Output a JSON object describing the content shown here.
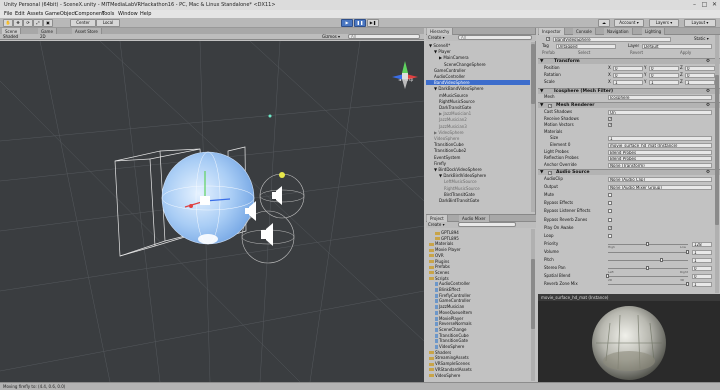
{
  "window": {
    "title": "Unity Personal (64bit) - SceneX.unity - MITMediaLabVRHackathon16 - PC, Mac & Linux Standalone* <DX11>",
    "minimize": "–",
    "maximize": "□",
    "close": "✕"
  },
  "menu": [
    "File",
    "Edit",
    "Assets",
    "GameObject",
    "Component",
    "Tools",
    "Window",
    "Help"
  ],
  "toolbar": {
    "center_label": "Center",
    "local_label": "Local",
    "play_icon": "▶",
    "pause_icon": "❚❚",
    "step_icon": "▶❚",
    "account_label": "Account ▾",
    "layers_label": "Layers ▾",
    "layout_label": "Layout ▾",
    "cloud_icon": "☁"
  },
  "scene": {
    "tabs": [
      "Scene",
      "Game",
      "Asset Store"
    ],
    "shaded_label": "Shaded",
    "twod_label": "2D",
    "gizmos_label": "Gizmos ▾",
    "search_placeholder": "All",
    "persp_label": "◄ Persp"
  },
  "hierarchy": {
    "tab": "Hierarchy",
    "create_label": "Create ▾",
    "search_placeholder": "All",
    "items": [
      {
        "label": "▼ SceneX*",
        "indent": 0,
        "state": "normal"
      },
      {
        "label": "▼ Player",
        "indent": 1,
        "state": "normal"
      },
      {
        "label": "▶ MainCamera",
        "indent": 2,
        "state": "normal"
      },
      {
        "label": "SceneChangeSphere",
        "indent": 3,
        "state": "normal"
      },
      {
        "label": "GameController",
        "indent": 1,
        "state": "normal"
      },
      {
        "label": "AudioController",
        "indent": 1,
        "state": "normal"
      },
      {
        "label": "BandVideoSphere",
        "indent": 1,
        "state": "selected"
      },
      {
        "label": "▼ DarkBandVideoSphere",
        "indent": 1,
        "state": "normal"
      },
      {
        "label": "mMusicSource",
        "indent": 2,
        "state": "normal"
      },
      {
        "label": "RightMusicSource",
        "indent": 2,
        "state": "normal"
      },
      {
        "label": "DarkTransitGate",
        "indent": 2,
        "state": "normal"
      },
      {
        "label": "▶ JazzMusician1",
        "indent": 2,
        "state": "gray"
      },
      {
        "label": "JazzMusician2",
        "indent": 2,
        "state": "gray"
      },
      {
        "label": "JazzMusician3",
        "indent": 2,
        "state": "gray"
      },
      {
        "label": "▶ VideoSphere",
        "indent": 1,
        "state": "gray"
      },
      {
        "label": "VideoSphere",
        "indent": 1,
        "state": "gray"
      },
      {
        "label": "TransitionCube",
        "indent": 1,
        "state": "normal"
      },
      {
        "label": "TransitionCube2",
        "indent": 1,
        "state": "normal"
      },
      {
        "label": "EventSystem",
        "indent": 1,
        "state": "normal"
      },
      {
        "label": "Firefly",
        "indent": 1,
        "state": "normal"
      },
      {
        "label": "▼ BirdDockVideoSphere",
        "indent": 1,
        "state": "normal"
      },
      {
        "label": "▼ DarkBirdVideoSphere",
        "indent": 2,
        "state": "normal"
      },
      {
        "label": "LeftMusicSource",
        "indent": 3,
        "state": "gray"
      },
      {
        "label": "RightMusicSource",
        "indent": 3,
        "state": "gray"
      },
      {
        "label": "BirdTransitGate",
        "indent": 3,
        "state": "normal"
      },
      {
        "label": "DarkBirdTransitGate",
        "indent": 2,
        "state": "normal"
      }
    ]
  },
  "project": {
    "tabs": [
      "Project",
      "Audio Mixer"
    ],
    "create_label": "Create ▾",
    "items": [
      {
        "label": "GPTL894",
        "kind": "folder",
        "indent": 1
      },
      {
        "label": "GPTL895",
        "kind": "folder",
        "indent": 1
      },
      {
        "label": "Materials",
        "kind": "folder",
        "indent": 0
      },
      {
        "label": "Movie Player",
        "kind": "folder",
        "indent": 0
      },
      {
        "label": "OVR",
        "kind": "folder",
        "indent": 0
      },
      {
        "label": "Plugins",
        "kind": "folder",
        "indent": 0
      },
      {
        "label": "Prefabs",
        "kind": "folder",
        "indent": 0
      },
      {
        "label": "Scenes",
        "kind": "folder",
        "indent": 0
      },
      {
        "label": "Scripts",
        "kind": "folder",
        "indent": 0
      },
      {
        "label": "AudioController",
        "kind": "script",
        "indent": 1
      },
      {
        "label": "BlinkEffect",
        "kind": "script",
        "indent": 1
      },
      {
        "label": "FireflyController",
        "kind": "script",
        "indent": 1
      },
      {
        "label": "GameController",
        "kind": "script",
        "indent": 1
      },
      {
        "label": "JazzMusician",
        "kind": "script",
        "indent": 1
      },
      {
        "label": "MoveQueueItem",
        "kind": "script",
        "indent": 1
      },
      {
        "label": "MoviePlayer",
        "kind": "script",
        "indent": 1
      },
      {
        "label": "ReverseNormals",
        "kind": "script",
        "indent": 1
      },
      {
        "label": "SceneChange",
        "kind": "script",
        "indent": 1
      },
      {
        "label": "TransitionCube",
        "kind": "script",
        "indent": 1
      },
      {
        "label": "TransitionGate",
        "kind": "script",
        "indent": 1
      },
      {
        "label": "VideoSphere",
        "kind": "script",
        "indent": 1
      },
      {
        "label": "Shaders",
        "kind": "folder",
        "indent": 0
      },
      {
        "label": "StreamingAssets",
        "kind": "folder",
        "indent": 0
      },
      {
        "label": "VRSampleScenes",
        "kind": "folder",
        "indent": 0
      },
      {
        "label": "VRStandardAssets",
        "kind": "folder",
        "indent": 0
      },
      {
        "label": "VideoSphere",
        "kind": "folder",
        "indent": 0
      }
    ]
  },
  "inspector": {
    "tabs": [
      "Inspector",
      "Console",
      "Navigation",
      "Lighting"
    ],
    "object_name": "BandVideoSphere",
    "static_label": "Static ▾",
    "tag_label": "Tag",
    "tag_value": "Untagged",
    "layer_label": "Layer",
    "layer_value": "Default",
    "prefab_label": "Prefab",
    "select_label": "Select",
    "revert_label": "Revert",
    "apply_label": "Apply",
    "transform": {
      "header": "Transform",
      "rows": [
        {
          "label": "Position",
          "x": "0",
          "y": "0",
          "z": "0"
        },
        {
          "label": "Rotation",
          "x": "0",
          "y": "0",
          "z": "0"
        },
        {
          "label": "Scale",
          "x": "1",
          "y": "1",
          "z": "1"
        }
      ]
    },
    "mesh_filter": {
      "header": "Icosphere (Mesh Filter)",
      "mesh_label": "Mesh",
      "mesh_value": "Icosphere"
    },
    "mesh_renderer": {
      "header": "Mesh Renderer",
      "rows": [
        {
          "label": "Cast Shadows",
          "value": "On"
        },
        {
          "label": "Receive Shadows",
          "check": true
        },
        {
          "label": "Motion Vectors",
          "check": true
        },
        {
          "label": "Materials",
          "value": ""
        },
        {
          "label": "Size",
          "value": "1"
        },
        {
          "label": "Element 0",
          "value": "movie_surface_hd_mat (Instance)"
        },
        {
          "label": "Light Probes",
          "value": "Blend Probes"
        },
        {
          "label": "Reflection Probes",
          "value": "Blend Probes"
        },
        {
          "label": "Anchor Override",
          "value": "None (Transform)"
        }
      ]
    },
    "audio_source": {
      "header": "Audio Source",
      "rows": [
        {
          "label": "AudioClip",
          "value": "None (Audio Clip)",
          "kind": "field"
        },
        {
          "label": "Output",
          "value": "None (Audio Mixer Group)",
          "kind": "field"
        },
        {
          "label": "Mute",
          "kind": "check",
          "on": false
        },
        {
          "label": "Bypass Effects",
          "kind": "check",
          "on": false
        },
        {
          "label": "Bypass Listener Effects",
          "kind": "check",
          "on": false
        },
        {
          "label": "Bypass Reverb Zones",
          "kind": "check",
          "on": false
        },
        {
          "label": "Play On Awake",
          "kind": "check",
          "on": true
        },
        {
          "label": "Loop",
          "kind": "check",
          "on": false
        },
        {
          "label": "Priority",
          "kind": "slider",
          "value": "128",
          "level": 0.5
        },
        {
          "label": "Volume",
          "kind": "slider",
          "value": "1",
          "level": 1.0
        },
        {
          "label": "Pitch",
          "kind": "slider",
          "value": "1",
          "level": 0.67
        },
        {
          "label": "Stereo Pan",
          "kind": "slider",
          "value": "0",
          "level": 0.5
        },
        {
          "label": "Spatial Blend",
          "kind": "slider",
          "value": "0",
          "level": 0.0
        },
        {
          "label": "Reverb Zone Mix",
          "kind": "slider",
          "value": "1",
          "level": 1.0
        }
      ],
      "priority_marks": [
        "High",
        "Low"
      ],
      "pan_marks": [
        "Left",
        "Right"
      ],
      "blend_marks": [
        "2D",
        "3D"
      ]
    },
    "preview_title": "movie_surface_hd_mat (Instance)"
  },
  "status_bar": {
    "text": "Moving firefly to: (4.4, 0.6, 0.0)"
  },
  "colors": {
    "selection": "#3d6dcc",
    "scene_bg": "#3a3d40",
    "panel": "#c2c2c2",
    "play_blue": "#4a77c2"
  }
}
